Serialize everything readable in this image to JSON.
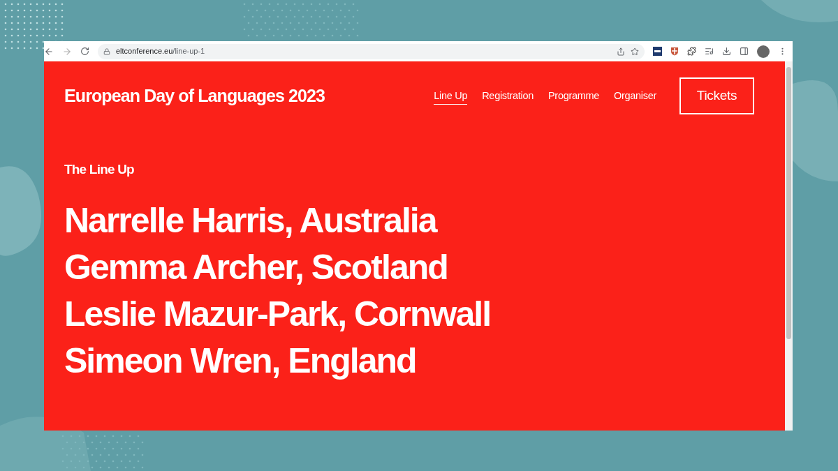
{
  "browser": {
    "url_host": "eltconference.eu",
    "url_path": "/line-up-1"
  },
  "site": {
    "title": "European Day of Languages 2023",
    "nav": [
      {
        "label": "Line Up",
        "selected": true
      },
      {
        "label": "Registration",
        "selected": false
      },
      {
        "label": "Programme",
        "selected": false
      },
      {
        "label": "Organiser",
        "selected": false
      }
    ],
    "tickets_button": "Tickets"
  },
  "section_title": "The Line Up",
  "speakers": [
    "Narrelle Harris, Australia",
    "Gemma Archer, Scotland",
    "Leslie Mazur-Park, Cornwall",
    "Simeon Wren, England"
  ]
}
